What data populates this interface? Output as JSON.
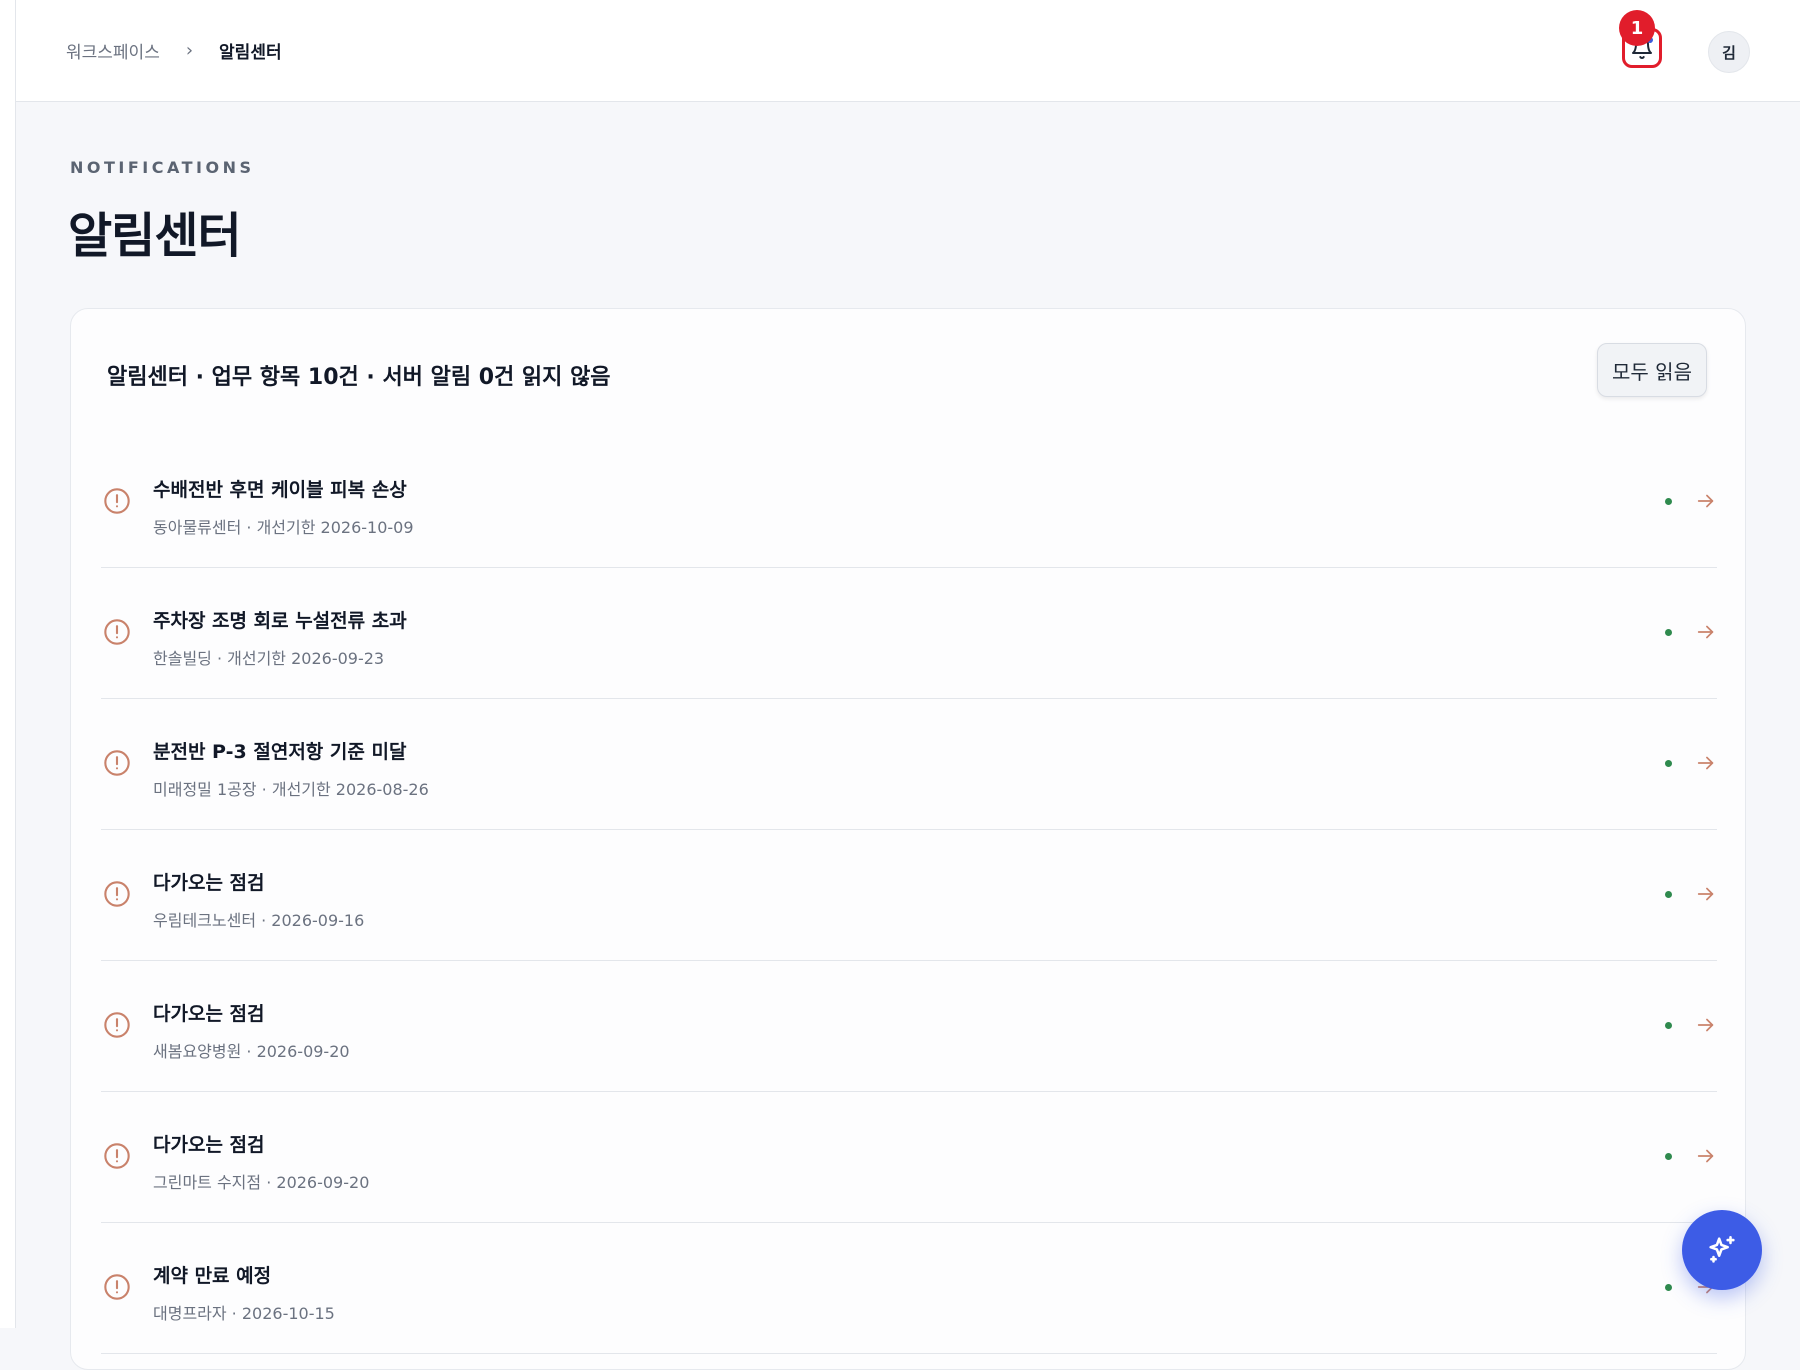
{
  "breadcrumb": {
    "root": "워크스페이스",
    "separator": "›",
    "current": "알림센터"
  },
  "header": {
    "bell_badge_count": "1",
    "avatar_initial": "김",
    "bell_icon": "bell-icon"
  },
  "page": {
    "eyebrow": "NOTIFICATIONS",
    "title": "알림센터"
  },
  "card": {
    "summary": "알림센터 · 업무 항목 10건 · 서버 알림 0건 읽지 않음",
    "read_all_label": "모두 읽음"
  },
  "items": [
    {
      "title": "수배전반 후면 케이블 피복 손상",
      "meta": "동아물류센터 · 개선기한 2026-10-09"
    },
    {
      "title": "주차장 조명 회로 누설전류 초과",
      "meta": "한솔빌딩 · 개선기한 2026-09-23"
    },
    {
      "title": "분전반 P-3 절연저항 기준 미달",
      "meta": "미래정밀 1공장 · 개선기한 2026-08-26"
    },
    {
      "title": "다가오는 점검",
      "meta": "우림테크노센터 · 2026-09-16"
    },
    {
      "title": "다가오는 점검",
      "meta": "새봄요양병원 · 2026-09-20"
    },
    {
      "title": "다가오는 점검",
      "meta": "그린마트 수지점 · 2026-09-20"
    },
    {
      "title": "계약 만료 예정",
      "meta": "대명프라자 · 2026-10-15"
    }
  ],
  "colors": {
    "accent": "#3d5ce6",
    "badge": "#e11d2b",
    "warning_icon": "#c9826b",
    "status_dot": "#2f8a4e"
  }
}
